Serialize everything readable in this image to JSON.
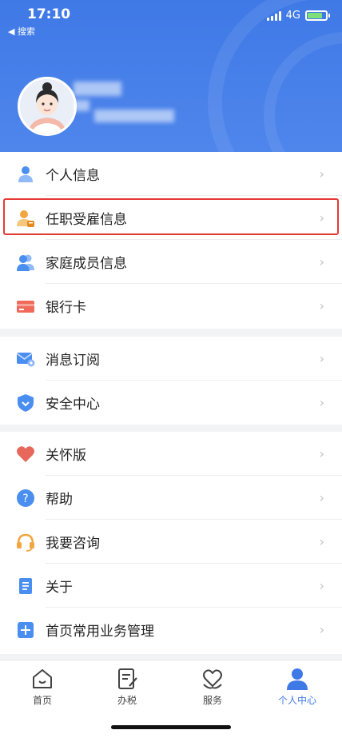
{
  "status_bar": {
    "time": "17:10",
    "back_label": "◀ 搜索",
    "network": "4G"
  },
  "profile": {
    "avatar_icon": "woman-avatar-icon"
  },
  "menu_group_1": [
    {
      "label": "个人信息",
      "icon": "person-icon"
    },
    {
      "label": "任职受雇信息",
      "icon": "employment-icon"
    },
    {
      "label": "家庭成员信息",
      "icon": "family-icon"
    },
    {
      "label": "银行卡",
      "icon": "bank-card-icon"
    }
  ],
  "menu_group_2": [
    {
      "label": "消息订阅",
      "icon": "mail-subscribe-icon"
    },
    {
      "label": "安全中心",
      "icon": "shield-icon"
    }
  ],
  "menu_group_3": [
    {
      "label": "关怀版",
      "icon": "heart-icon"
    },
    {
      "label": "帮助",
      "icon": "help-icon"
    },
    {
      "label": "我要咨询",
      "icon": "headset-icon"
    },
    {
      "label": "关于",
      "icon": "document-icon"
    },
    {
      "label": "首页常用业务管理",
      "icon": "plus-icon"
    }
  ],
  "tabs": [
    {
      "label": "首页",
      "icon": "home-icon"
    },
    {
      "label": "办税",
      "icon": "tax-form-icon"
    },
    {
      "label": "服务",
      "icon": "service-heart-icon"
    },
    {
      "label": "个人中心",
      "icon": "user-center-icon",
      "active": true
    }
  ],
  "colors": {
    "primary": "#3f79e6",
    "highlight": "#e53935"
  }
}
